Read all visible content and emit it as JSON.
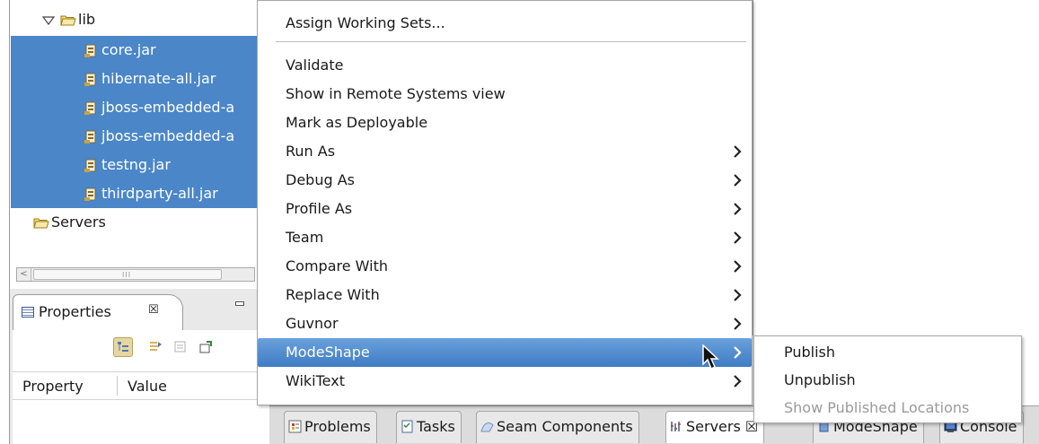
{
  "explorer": {
    "lib_folder": "lib",
    "files": [
      {
        "name": "core.jar"
      },
      {
        "name": "hibernate-all.jar"
      },
      {
        "name": "jboss-embedded-a"
      },
      {
        "name": "jboss-embedded-a"
      },
      {
        "name": "testng.jar"
      },
      {
        "name": "thirdparty-all.jar"
      }
    ],
    "servers_folder": "Servers",
    "scroll_grip": "III"
  },
  "properties": {
    "tab_title": "Properties",
    "close_glyph": "☒",
    "col_property": "Property",
    "col_value": "Value"
  },
  "context_menu": {
    "items": [
      {
        "label": "Assign Working Sets...",
        "submenu": false
      },
      {
        "label": "Validate",
        "submenu": false
      },
      {
        "label": "Show in Remote Systems view",
        "submenu": false
      },
      {
        "label": "Mark as Deployable",
        "submenu": false
      },
      {
        "label": "Run As",
        "submenu": true
      },
      {
        "label": "Debug As",
        "submenu": true
      },
      {
        "label": "Profile As",
        "submenu": true
      },
      {
        "label": "Team",
        "submenu": true
      },
      {
        "label": "Compare With",
        "submenu": true
      },
      {
        "label": "Replace With",
        "submenu": true
      },
      {
        "label": "Guvnor",
        "submenu": true
      },
      {
        "label": "ModeShape",
        "submenu": true,
        "highlighted": true
      },
      {
        "label": "WikiText",
        "submenu": true
      }
    ]
  },
  "submenu": {
    "items": [
      {
        "label": "Publish",
        "enabled": true
      },
      {
        "label": "Unpublish",
        "enabled": true
      },
      {
        "label": "Show Published Locations",
        "enabled": false
      }
    ]
  },
  "bottom_tabs": [
    {
      "label": "Problems"
    },
    {
      "label": "Tasks"
    },
    {
      "label": "Seam Components"
    },
    {
      "label": "Servers ☒",
      "active": true
    },
    {
      "label": "ModeShape"
    },
    {
      "label": "Console"
    }
  ],
  "colors": {
    "selection": "#4a86c8",
    "menu_highlight": "#3f7cc4",
    "disabled_text": "#9a9a9a"
  }
}
